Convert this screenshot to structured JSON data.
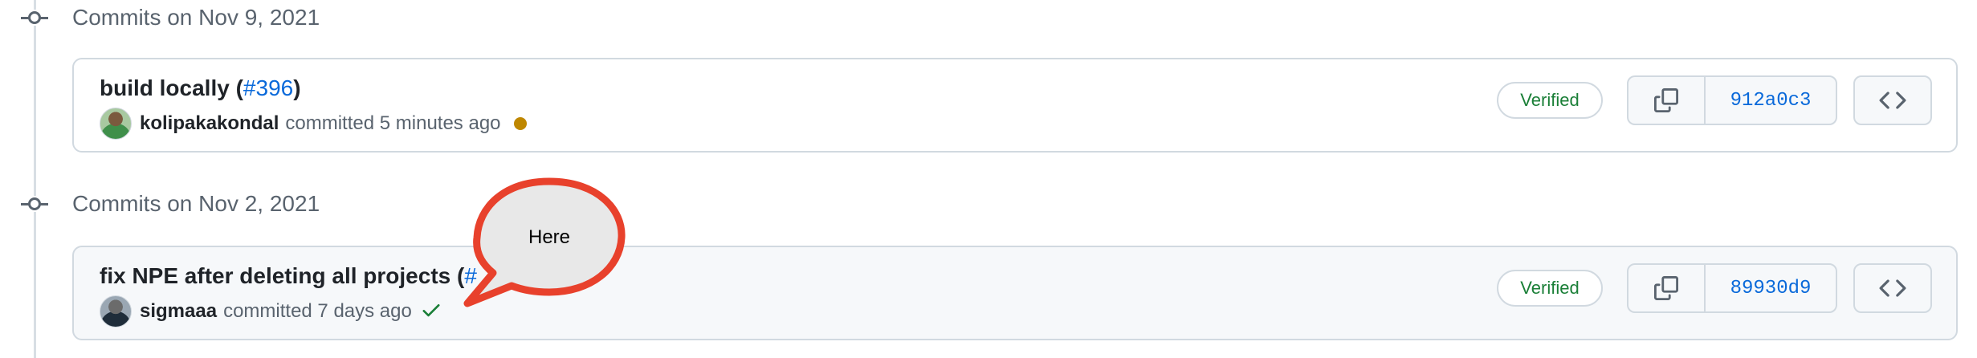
{
  "groups": [
    {
      "date_label": "Commits on Nov 9, 2021",
      "commit": {
        "title": "build locally (",
        "pr_ref": "#396",
        "title_suffix": ")",
        "author": "kolipakakondal",
        "action": "committed 5 minutes ago",
        "status": "pending",
        "verified_label": "Verified",
        "sha": "912a0c3"
      }
    },
    {
      "date_label": "Commits on Nov 2, 2021",
      "commit": {
        "title": "fix NPE after deleting all projects (",
        "pr_ref": "#",
        "title_suffix": "",
        "author": "sigmaaa",
        "action": "committed 7 days ago",
        "status": "success",
        "verified_label": "Verified",
        "sha": "89930d9"
      }
    }
  ],
  "callout": {
    "text": "Here"
  },
  "colors": {
    "accent": "#0969da",
    "verified": "#1a7f37",
    "pending": "#bf8700",
    "callout_border": "#e8412c",
    "callout_fill": "#e8e8e8"
  },
  "icons": {
    "timeline": "git-commit-icon",
    "copy": "copy-icon",
    "browse": "code-icon",
    "status_pending": "pending-dot-icon",
    "status_success": "check-icon"
  }
}
